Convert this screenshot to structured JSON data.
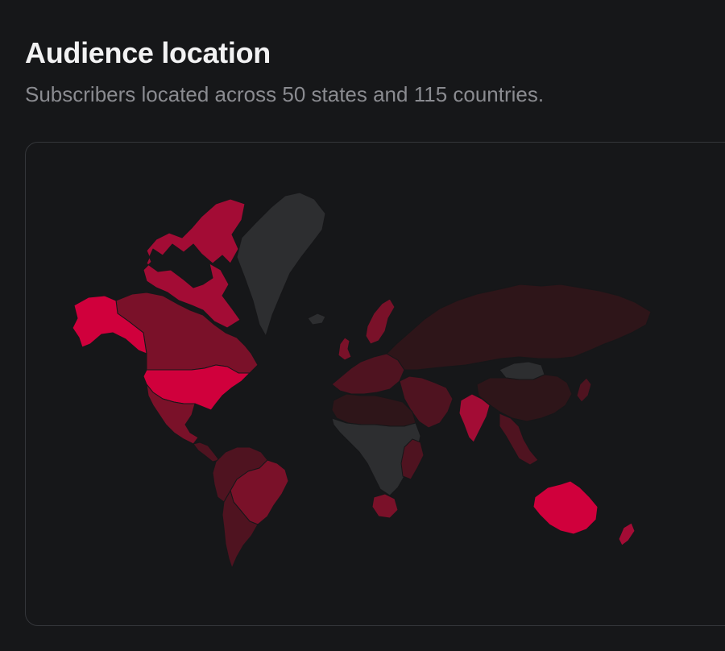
{
  "header": {
    "title": "Audience location",
    "subtitle": "Subscribers located across 50 states and 115 countries."
  },
  "map": {
    "colors": {
      "level_high": "#d0003c",
      "level_mid_high": "#a30c35",
      "level_mid": "#7a1129",
      "level_low": "#4f1320",
      "level_very_low": "#2e1519",
      "no_data": "#2d2e30",
      "border": "#161719"
    },
    "regions": [
      {
        "id": "alaska",
        "level": "high"
      },
      {
        "id": "canada",
        "level": "mid"
      },
      {
        "id": "canadian-arctic",
        "level": "mid_high"
      },
      {
        "id": "greenland",
        "level": "no_data"
      },
      {
        "id": "usa",
        "level": "high"
      },
      {
        "id": "mexico",
        "level": "mid"
      },
      {
        "id": "central-america",
        "level": "low"
      },
      {
        "id": "brazil",
        "level": "mid"
      },
      {
        "id": "south-america-north",
        "level": "low"
      },
      {
        "id": "argentina-chile",
        "level": "low"
      },
      {
        "id": "europe-west",
        "level": "low"
      },
      {
        "id": "uk",
        "level": "mid"
      },
      {
        "id": "scandinavia",
        "level": "mid"
      },
      {
        "id": "russia",
        "level": "very_low"
      },
      {
        "id": "china",
        "level": "very_low"
      },
      {
        "id": "mongolia",
        "level": "no_data"
      },
      {
        "id": "middle-east",
        "level": "low"
      },
      {
        "id": "india",
        "level": "mid_high"
      },
      {
        "id": "southeast-asia",
        "level": "low"
      },
      {
        "id": "japan",
        "level": "low"
      },
      {
        "id": "north-africa",
        "level": "very_low"
      },
      {
        "id": "sub-saharan-africa",
        "level": "no_data"
      },
      {
        "id": "east-africa",
        "level": "low"
      },
      {
        "id": "south-africa",
        "level": "mid"
      },
      {
        "id": "australia",
        "level": "high"
      },
      {
        "id": "new-zealand",
        "level": "mid_high"
      },
      {
        "id": "iceland",
        "level": "no_data"
      }
    ]
  }
}
